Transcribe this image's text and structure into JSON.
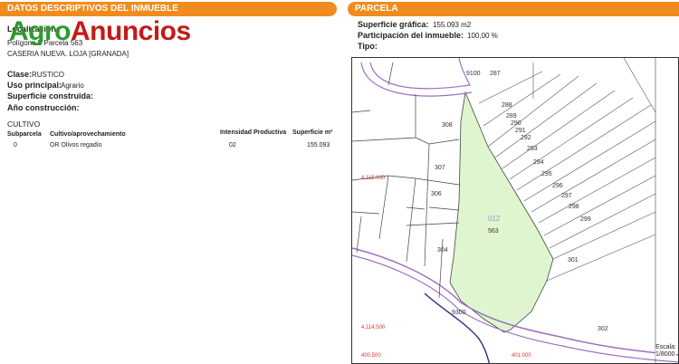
{
  "left": {
    "header": "DATOS DESCRIPTIVOS DEL INMUEBLE",
    "logo": {
      "agro": "Agro",
      "anuncios": "Anuncios"
    },
    "localizacion_label": "Localización:",
    "poligono": "Polígono 5 Parcela 563",
    "lugar": "CASERIA NUEVA. LOJA [GRANADA]",
    "clase_label": "Clase:",
    "clase_value": "RUSTICO",
    "uso_label": "Uso principal:",
    "uso_value": "Agrario",
    "sup_construida_label": "Superficie construida:",
    "anio_label": "Año construcción:",
    "cultivo_title": "CULTIVO",
    "table": {
      "headers": [
        "Subparcela",
        "Cultivo/aprovechamiento",
        "Intensidad Productiva",
        "Superficie m²"
      ],
      "rows": [
        [
          "0",
          "OR Olivos regadío",
          "02",
          "155.093"
        ]
      ]
    }
  },
  "right": {
    "header": "PARCELA",
    "sup_grafica_label": "Superficie gráfica:",
    "sup_grafica_value": "155.093 m2",
    "participacion_label": "Participación del inmueble:",
    "participacion_value": "100,00 %",
    "tipo_label": "Tipo:"
  },
  "map": {
    "parcel_numbers": [
      "9100",
      "287",
      "288",
      "289",
      "290",
      "291",
      "292",
      "293",
      "294",
      "295",
      "296",
      "297",
      "298",
      "299",
      "308",
      "307",
      "306",
      "304",
      "301",
      "302",
      "9300",
      "563"
    ],
    "polygon_label": "012",
    "coords": [
      "4.115.000",
      "4.114.500",
      "400.500",
      "401.000"
    ],
    "scale_label": "Escala:",
    "scale_value": "1/8000",
    "highlight_color": "#dff5cf"
  }
}
